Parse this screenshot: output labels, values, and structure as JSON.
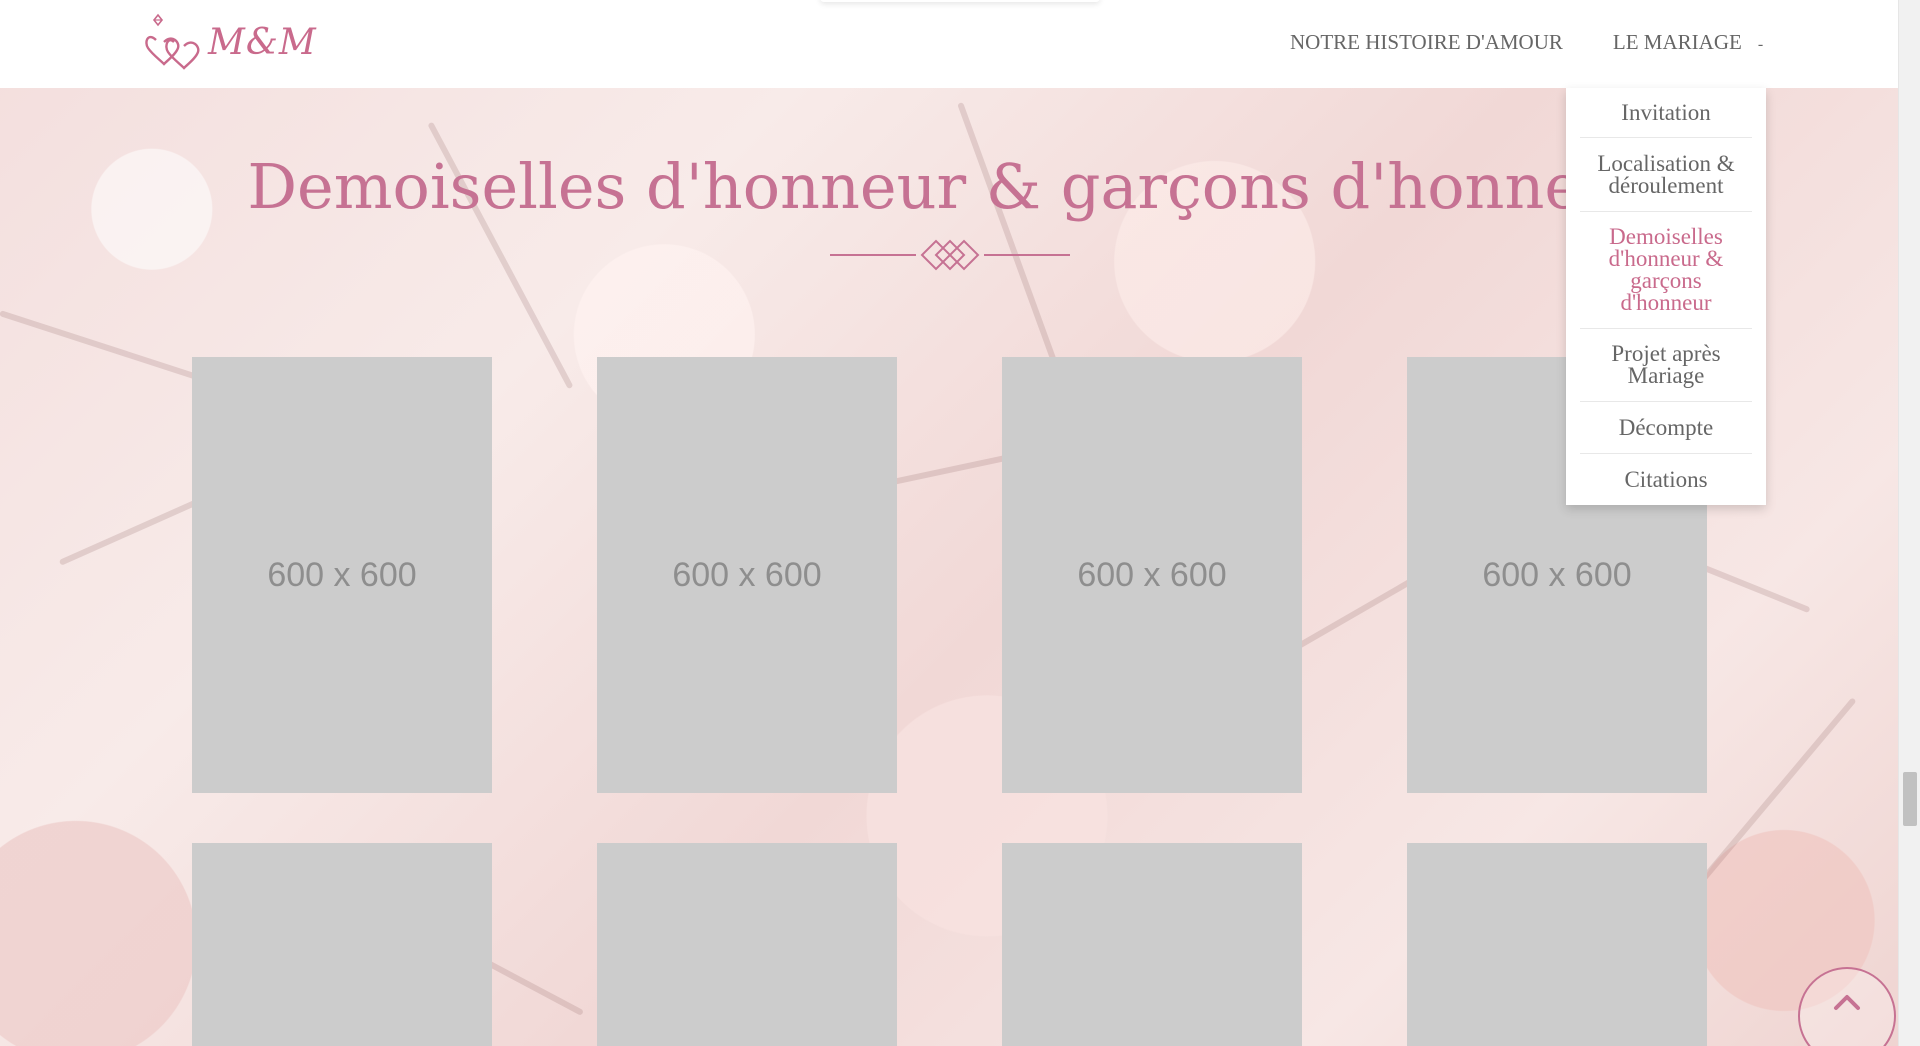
{
  "brand": {
    "logo_text": "M&M",
    "logo_icon": "interlocked-hearts-ring-icon"
  },
  "nav": {
    "items": [
      {
        "label": "NOTRE HISTOIRE D'AMOUR"
      },
      {
        "label": "LE MARIAGE"
      }
    ],
    "caret": "-"
  },
  "dropdown": {
    "items": [
      {
        "label": "Invitation",
        "active": false
      },
      {
        "label": "Localisation & déroulement",
        "active": false
      },
      {
        "label": "Demoiselles d'honneur & garçons d'honneur",
        "active": true
      },
      {
        "label": "Projet après Mariage",
        "active": false
      },
      {
        "label": "Décompte",
        "active": false
      },
      {
        "label": "Citations",
        "active": false
      }
    ]
  },
  "section": {
    "title": "Demoiselles d'honneur & garçons d'honneur",
    "divider_icon": "diamond-ornament-icon"
  },
  "gallery": {
    "cards": [
      {
        "label": "600 x 600"
      },
      {
        "label": "600 x 600"
      },
      {
        "label": "600 x 600"
      },
      {
        "label": "600 x 600"
      },
      {
        "label": ""
      },
      {
        "label": ""
      },
      {
        "label": ""
      },
      {
        "label": ""
      }
    ]
  },
  "back_to_top": {
    "icon": "chevron-up-icon"
  },
  "colors": {
    "accent": "#c67293",
    "nav_text": "#666666",
    "placeholder_bg": "#cccccc",
    "placeholder_text": "#8e8e8e"
  }
}
